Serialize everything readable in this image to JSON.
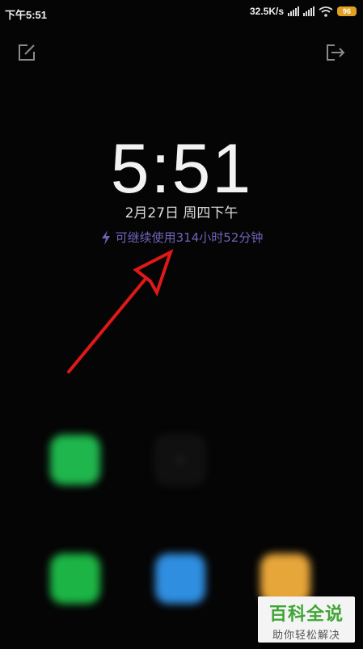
{
  "status_bar": {
    "time": "下午5:51",
    "network_speed": "32.5K/s",
    "battery_level": "96"
  },
  "icons": {
    "top_left": "edit-icon",
    "top_right": "exit-icon"
  },
  "lock_screen": {
    "clock": "5:51",
    "date": "2月27日 周四下午",
    "charge_text": "可继续使用314小时52分钟"
  },
  "apps": [
    {
      "icon": "wechat-icon",
      "color": "#1fb64d"
    },
    {
      "icon": "add-icon",
      "color": "#101010"
    },
    {
      "icon": "phone-icon",
      "color": "#1cb545"
    },
    {
      "icon": "contacts-icon",
      "color": "#2f8ee0"
    },
    {
      "icon": "message-icon",
      "color": "#e7a63a"
    }
  ],
  "watermark": {
    "title": "百科全说",
    "subtitle": "助你轻松解决"
  },
  "colors": {
    "background": "#050505",
    "charge_text": "#6d64ba",
    "annotation_arrow": "#e01818"
  }
}
